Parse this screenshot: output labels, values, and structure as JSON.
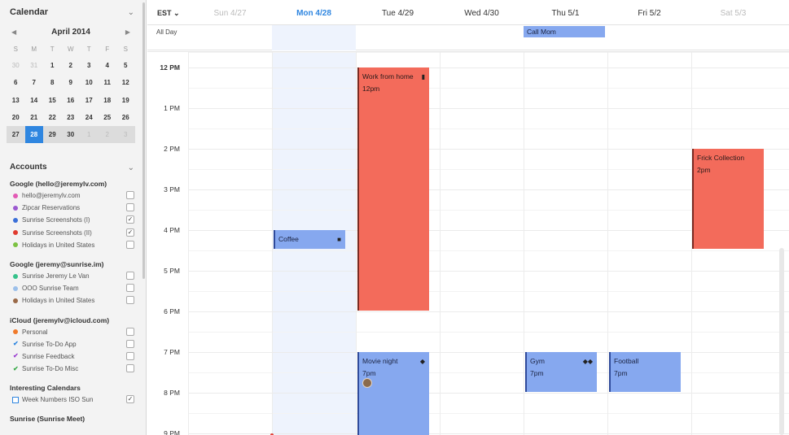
{
  "sidebar": {
    "title": "Calendar",
    "mini_calendar": {
      "month_label": "April 2014",
      "prev_arrow": "◀",
      "next_arrow": "▶",
      "weekdays": [
        "S",
        "M",
        "T",
        "W",
        "T",
        "F",
        "S"
      ],
      "weeks": [
        [
          "30",
          "31",
          "1",
          "2",
          "3",
          "4",
          "5"
        ],
        [
          "6",
          "7",
          "8",
          "9",
          "10",
          "11",
          "12"
        ],
        [
          "13",
          "14",
          "15",
          "16",
          "17",
          "18",
          "19"
        ],
        [
          "20",
          "21",
          "22",
          "23",
          "24",
          "25",
          "26"
        ],
        [
          "27",
          "28",
          "29",
          "30",
          "1",
          "2",
          "3"
        ]
      ],
      "selected_day": "28"
    },
    "accounts_title": "Accounts",
    "groups": [
      {
        "title": "Google (hello@jeremylv.com)",
        "items": [
          {
            "label": "hello@jeremylv.com",
            "marker": "dot",
            "color": "#e35ab5",
            "checked": ""
          },
          {
            "label": "Zipcar Reservations",
            "marker": "dot",
            "color": "#9b59d0",
            "checked": ""
          },
          {
            "label": "Sunrise Screenshots (I)",
            "marker": "dot",
            "color": "#3a6fd8",
            "checked": "✓"
          },
          {
            "label": "Sunrise Screenshots (II)",
            "marker": "dot",
            "color": "#e03b2f",
            "checked": "✓"
          },
          {
            "label": "Holidays in United States",
            "marker": "dot",
            "color": "#7cc242",
            "checked": ""
          }
        ]
      },
      {
        "title": "Google (jeremy@sunrise.im)",
        "items": [
          {
            "label": "Sunrise Jeremy Le Van",
            "marker": "dot",
            "color": "#36c28a",
            "checked": ""
          },
          {
            "label": "OOO Sunrise Team",
            "marker": "dot",
            "color": "#9cc0ea",
            "checked": ""
          },
          {
            "label": "Holidays in United States",
            "marker": "dot",
            "color": "#9a6a48",
            "checked": ""
          }
        ]
      },
      {
        "title": "iCloud (jeremylv@icloud.com)",
        "items": [
          {
            "label": "Personal",
            "marker": "dot",
            "color": "#f07a2a",
            "checked": ""
          },
          {
            "label": "Sunrise To-Do App",
            "marker": "tick",
            "color": "#2f86e0",
            "checked": ""
          },
          {
            "label": "Sunrise Feedback",
            "marker": "tick",
            "color": "#9b3fd0",
            "checked": ""
          },
          {
            "label": "Sunrise To-Do Misc",
            "marker": "tick",
            "color": "#3aa94a",
            "checked": ""
          }
        ]
      },
      {
        "title": "Interesting Calendars",
        "items": [
          {
            "label": "Week Numbers ISO Sun",
            "marker": "square",
            "color": "#2f86e0",
            "checked": "✓"
          }
        ]
      },
      {
        "title": "Sunrise (Sunrise Meet)",
        "items": []
      }
    ]
  },
  "header": {
    "timezone": "EST ⌄",
    "days": [
      {
        "label": "Sun 4/27",
        "state": "faded"
      },
      {
        "label": "Mon 4/28",
        "state": "today"
      },
      {
        "label": "Tue 4/29",
        "state": "normal"
      },
      {
        "label": "Wed 4/30",
        "state": "normal"
      },
      {
        "label": "Thu 5/1",
        "state": "normal"
      },
      {
        "label": "Fri 5/2",
        "state": "normal"
      },
      {
        "label": "Sat 5/3",
        "state": "faded"
      }
    ],
    "all_day_label": "All Day"
  },
  "hours": [
    "12 PM",
    "1 PM",
    "2 PM",
    "3 PM",
    "4 PM",
    "5 PM",
    "6 PM",
    "7 PM",
    "8 PM",
    "9 PM"
  ],
  "events": {
    "call_mom": {
      "title": "Call Mom",
      "color": "#86a8ef"
    },
    "coffee": {
      "title": "Coffee",
      "icon": "■"
    },
    "work_from_home": {
      "title": "Work from home",
      "time": "12pm",
      "icon": "▮"
    },
    "frick_collection": {
      "title": "Frick Collection",
      "time": "2pm"
    },
    "movie_night": {
      "title": "Movie night",
      "time": "7pm",
      "icon": "◆"
    },
    "gym": {
      "title": "Gym",
      "time": "7pm",
      "icon": "◆◆"
    },
    "football": {
      "title": "Football",
      "time": "7pm"
    }
  },
  "colors": {
    "accent": "#2f86e0",
    "event_red": "#f36b5b",
    "event_blue": "#86a8ef",
    "today_column": "#eef3fd"
  }
}
